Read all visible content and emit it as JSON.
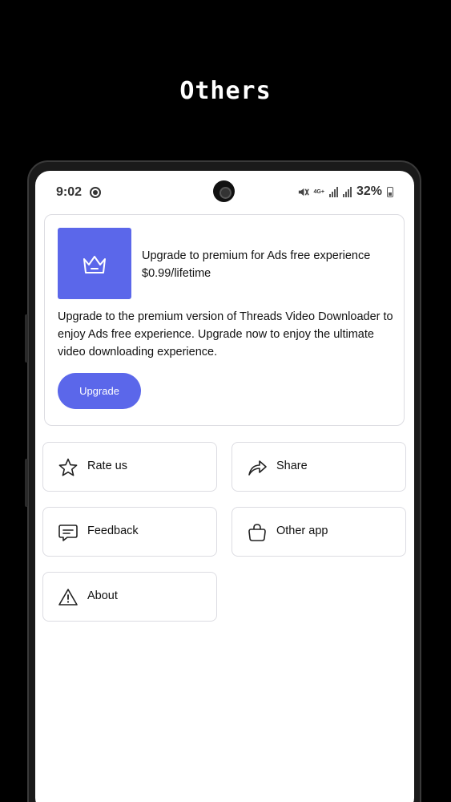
{
  "promo": {
    "heading": "Others"
  },
  "status_bar": {
    "time": "9:02",
    "network": "4G+",
    "battery": "32%"
  },
  "premium": {
    "title": "Upgrade to premium for Ads free experience",
    "price": "$0.99/lifetime",
    "description": "Upgrade to the premium version of Threads Video Downloader to enjoy Ads free experience. Upgrade now to enjoy the ultimate video downloading experience.",
    "button_label": "Upgrade",
    "accent": "#5b67ea"
  },
  "options": [
    {
      "label": "Rate us",
      "icon": "star-icon"
    },
    {
      "label": "Share",
      "icon": "share-icon"
    },
    {
      "label": "Feedback",
      "icon": "feedback-icon"
    },
    {
      "label": "Other app",
      "icon": "shopping-bag-icon"
    },
    {
      "label": "About",
      "icon": "warning-icon"
    }
  ]
}
